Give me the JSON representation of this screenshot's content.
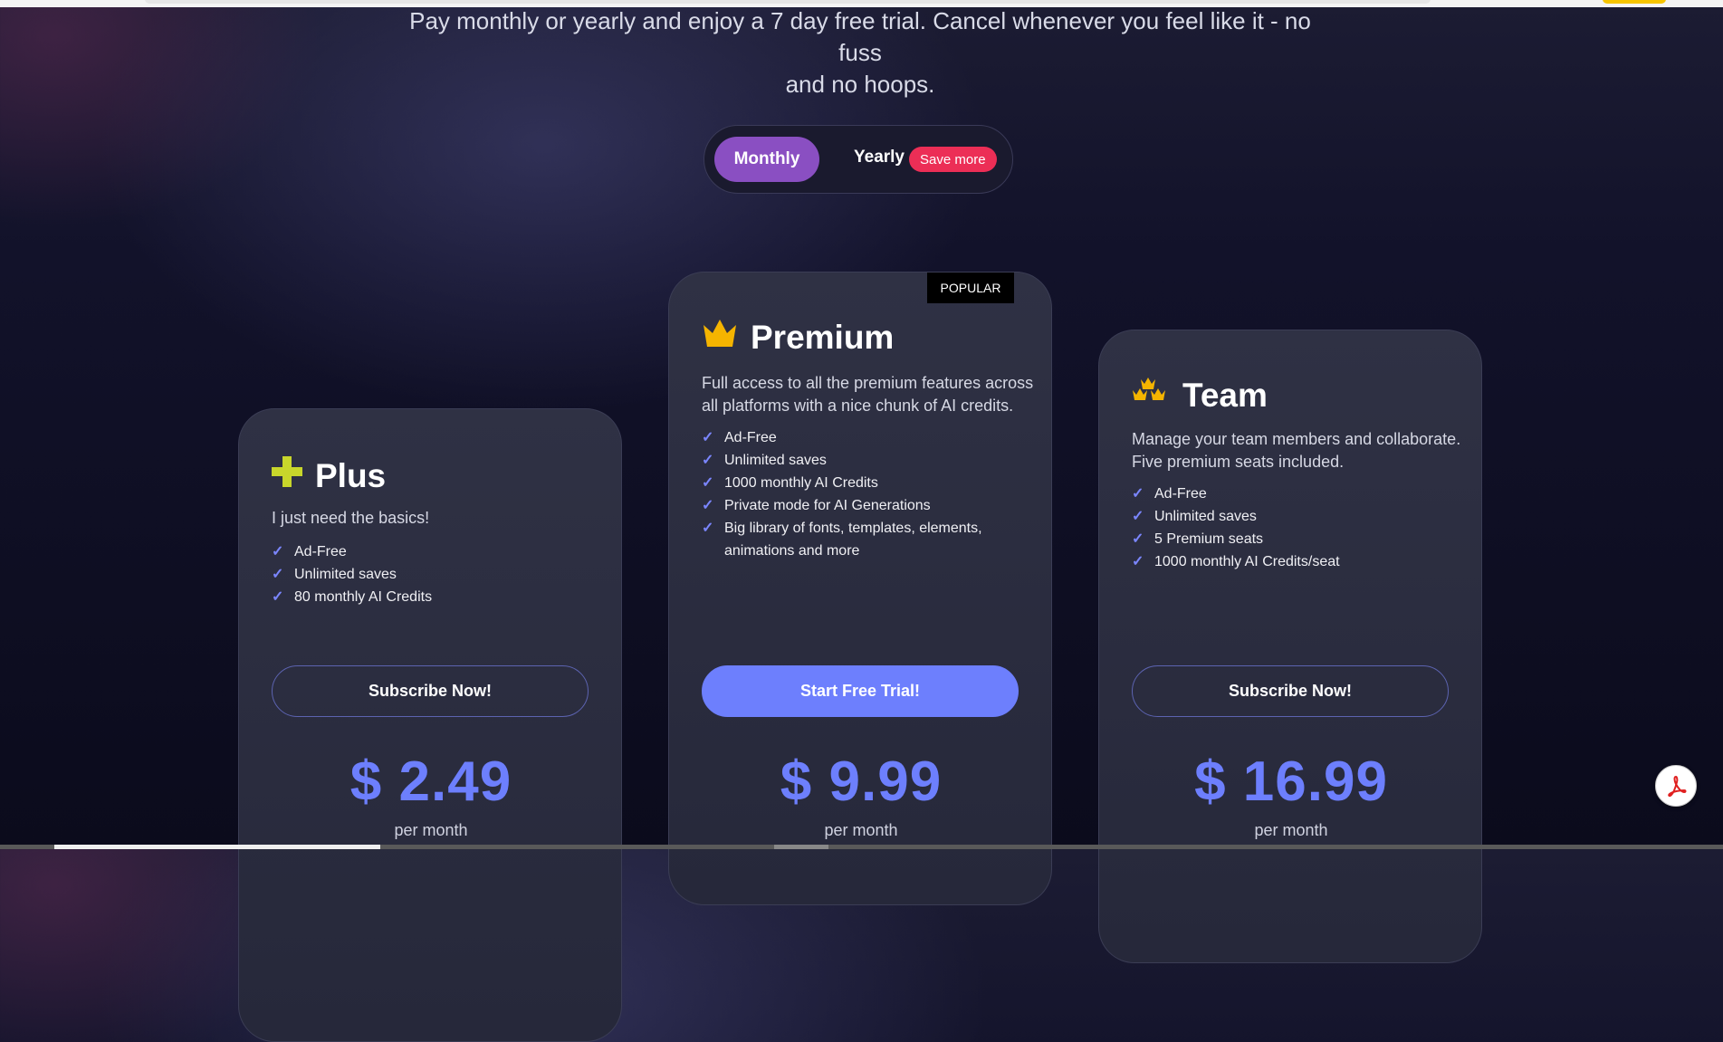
{
  "header": {
    "subtitle_line1": "Pay monthly or yearly and enjoy a 7 day free trial. Cancel whenever you feel like it - no fuss",
    "subtitle_line2": "and no hoops."
  },
  "billing_toggle": {
    "monthly_label": "Monthly",
    "yearly_label": "Yearly",
    "save_badge": "Save more",
    "selected": "Monthly"
  },
  "plans": [
    {
      "name": "Plus",
      "icon": "plus-icon",
      "description": "I just need the basics!",
      "features": [
        "Ad-Free",
        "Unlimited saves",
        "80 monthly AI Credits"
      ],
      "cta": "Subscribe Now!",
      "price": "$ 2.49",
      "period": "per month"
    },
    {
      "name": "Premium",
      "icon": "crown-icon",
      "badge": "POPULAR",
      "description": "Full access to all the premium features across all platforms with a nice chunk of AI credits.",
      "features": [
        "Ad-Free",
        "Unlimited saves",
        "1000 monthly AI Credits",
        "Private mode for AI Generations",
        "Big library of fonts, templates, elements, animations and more"
      ],
      "cta": "Start Free Trial!",
      "price": "$ 9.99",
      "period": "per month"
    },
    {
      "name": "Team",
      "icon": "crowns-icon",
      "description": "Manage your team members and collaborate. Five premium seats included.",
      "features": [
        "Ad-Free",
        "Unlimited saves",
        "5 Premium seats",
        "1000 monthly AI Credits/seat"
      ],
      "cta": "Subscribe Now!",
      "price": "$ 16.99",
      "period": "per month"
    }
  ],
  "check_glyph": "✓",
  "colors": {
    "accent": "#6d7ffd",
    "toggle_active": "#8a4fc2",
    "save_badge": "#ec2e56",
    "crown": "#f5b400",
    "plus_icon": "#c8d62b"
  }
}
